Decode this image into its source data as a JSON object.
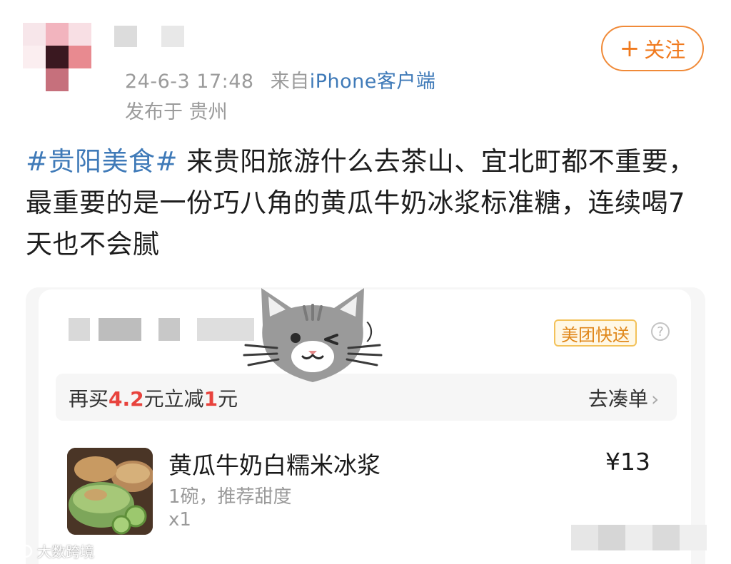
{
  "post": {
    "meta_time": "24-6-3 17:48",
    "meta_from": "来自",
    "meta_source": "iPhone客户端",
    "location": "发布于 贵州",
    "follow_label": "关注",
    "hashtag": "#贵阳美食#",
    "body": " 来贵阳旅游什么去茶山、宜北町都不重要，最重要的是一份巧八角的黄瓜牛奶冰浆标准糖，连续喝7天也不会腻"
  },
  "order_card": {
    "shop_paren": "）",
    "delivery_badge": "美团快送",
    "help_icon": "?",
    "promo": {
      "prefix": "再买",
      "amount": "4.2",
      "mid": "元立减",
      "discount": "1",
      "suffix": "元",
      "link": "去凑单",
      "link_chevron": "›"
    },
    "item": {
      "name": "黄瓜牛奶白糯米冰浆",
      "spec": "1碗，推荐甜度",
      "qty": "x1",
      "price": "¥13"
    }
  },
  "watermark": {
    "text": "大数跨境"
  },
  "colors": {
    "link_blue": "#3f7ab8",
    "follow_orange": "#f07a1e",
    "promo_red": "#e8433d",
    "meta_gray": "#9b9b9b"
  },
  "icons": [
    "plus-icon",
    "question-mark-icon",
    "chevron-right-icon",
    "cat-sticker-icon"
  ]
}
